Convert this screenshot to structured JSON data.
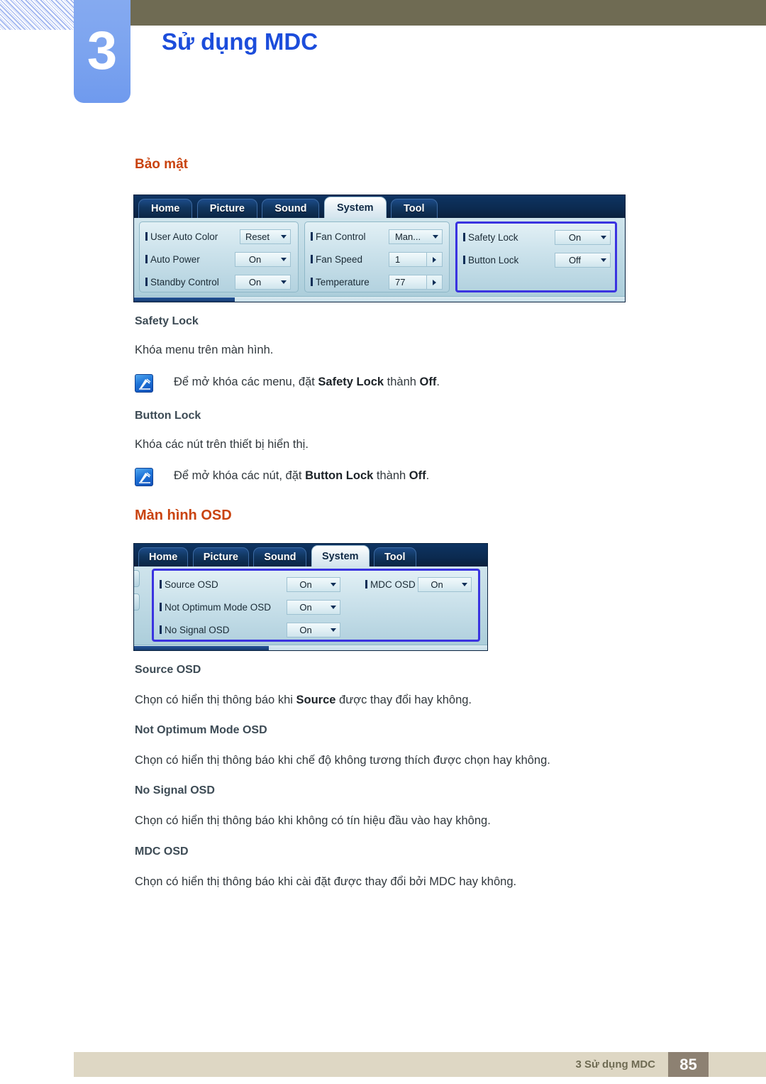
{
  "header": {
    "chapter_number": "3",
    "chapter_title": "Sử dụng MDC"
  },
  "sections": [
    {
      "heading": "Bảo mật",
      "subsections": [
        {
          "title": "Safety Lock",
          "body": "Khóa menu trên màn hình.",
          "note": {
            "icon": "note-pen-icon",
            "prefix": "Để mở khóa các menu, đặt ",
            "bold1": "Safety Lock",
            "mid": " thành ",
            "bold2": "Off",
            "suffix": "."
          }
        },
        {
          "title": "Button Lock",
          "body": "Khóa các nút trên thiết bị hiển thị.",
          "note": {
            "icon": "note-pen-icon",
            "prefix": "Để mở khóa các nút, đặt ",
            "bold1": "Button Lock",
            "mid": " thành ",
            "bold2": "Off",
            "suffix": "."
          }
        }
      ]
    },
    {
      "heading": "Màn hình OSD",
      "subsections": [
        {
          "title": "Source OSD",
          "body_prefix": "Chọn có hiển thị thông báo khi ",
          "body_bold": "Source",
          "body_suffix": " được thay đổi hay không."
        },
        {
          "title": "Not Optimum Mode OSD",
          "body": "Chọn có hiển thị thông báo khi chế độ không tương thích được chọn hay không."
        },
        {
          "title": "No Signal OSD",
          "body": "Chọn có hiển thị thông báo khi không có tín hiệu đầu vào hay không."
        },
        {
          "title": "MDC OSD",
          "body": "Chọn có hiển thị thông báo khi cài đặt được thay đổi bởi MDC hay không."
        }
      ]
    }
  ],
  "mdc_system": {
    "tabs": [
      {
        "label": "Home",
        "active": false
      },
      {
        "label": "Picture",
        "active": false
      },
      {
        "label": "Sound",
        "active": false
      },
      {
        "label": "System",
        "active": true
      },
      {
        "label": "Tool",
        "active": false
      }
    ],
    "groups": [
      {
        "name": "general-group",
        "highlighted": false,
        "rows": [
          {
            "label": "User Auto Color",
            "value": "Reset",
            "control": "dropdown"
          },
          {
            "label": "Auto Power",
            "value": "On",
            "control": "dropdown"
          },
          {
            "label": "Standby Control",
            "value": "On",
            "control": "dropdown"
          }
        ]
      },
      {
        "name": "fan-group",
        "highlighted": false,
        "rows": [
          {
            "label": "Fan Control",
            "value": "Man...",
            "control": "dropdown"
          },
          {
            "label": "Fan Speed",
            "value": "1",
            "control": "spinner"
          },
          {
            "label": "Temperature",
            "value": "77",
            "control": "spinner"
          }
        ]
      },
      {
        "name": "security-group",
        "highlighted": true,
        "rows": [
          {
            "label": "Safety Lock",
            "value": "On",
            "control": "dropdown"
          },
          {
            "label": "Button Lock",
            "value": "Off",
            "control": "dropdown"
          }
        ]
      }
    ]
  },
  "mdc_osd": {
    "tabs": [
      {
        "label": "Home",
        "active": false
      },
      {
        "label": "Picture",
        "active": false
      },
      {
        "label": "Sound",
        "active": false
      },
      {
        "label": "System",
        "active": true
      },
      {
        "label": "Tool",
        "active": false
      }
    ],
    "groups": [
      {
        "name": "osd-group",
        "highlighted": true,
        "rows": [
          {
            "label": "Source OSD",
            "value": "On",
            "control": "dropdown"
          },
          {
            "label": "Not Optimum Mode OSD",
            "value": "On",
            "control": "dropdown"
          },
          {
            "label": "No Signal OSD",
            "value": "On",
            "control": "dropdown"
          }
        ]
      },
      {
        "name": "mdc-osd-group",
        "highlighted": false,
        "rows": [
          {
            "label": "MDC OSD",
            "value": "On",
            "control": "dropdown"
          }
        ]
      }
    ]
  },
  "footer": {
    "text": "3 Sử dụng MDC",
    "page_number": "85"
  },
  "colors": {
    "accent_orange": "#c9430f",
    "chapter_blue": "#1c4ddb",
    "header_band": "#6f6b53",
    "footer_band": "#ded7c4",
    "page_box": "#8d8172",
    "highlight_border": "#3a33e0"
  }
}
